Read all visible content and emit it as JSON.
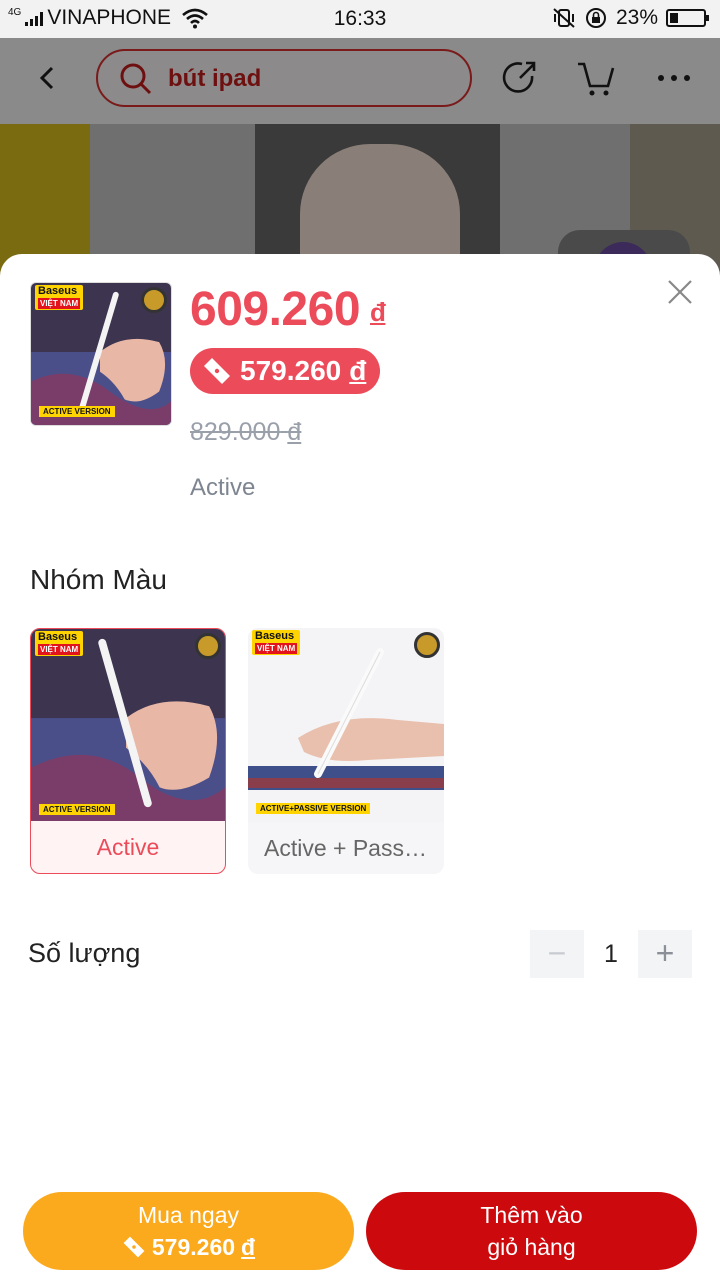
{
  "status_bar": {
    "network": "4G",
    "carrier": "VINAPHONE",
    "time": "16:33",
    "battery": "23%",
    "battery_level": 0.23
  },
  "header": {
    "search_query": "bút ipad",
    "icons": [
      "back-icon",
      "search-icon",
      "share-icon",
      "cart-icon",
      "more-icon"
    ]
  },
  "product": {
    "price": "609.260",
    "currency": "đ",
    "voucher_price": "579.260",
    "original_price": "829.000",
    "selected_variant": "Active",
    "image_badge": "Baseus",
    "image_badge_sub": "VIỆT NAM",
    "image_version": "ACTIVE VERSION"
  },
  "variants": {
    "title": "Nhóm Màu",
    "options": [
      {
        "label": "Active",
        "version": "ACTIVE VERSION",
        "selected": true
      },
      {
        "label": "Active + Passive",
        "version": "ACTIVE+PASSIVE VERSION",
        "selected": false
      }
    ]
  },
  "quantity": {
    "label": "Số lượng",
    "value": "1",
    "minus": "−",
    "plus": "+"
  },
  "actions": {
    "buy_label": "Mua ngay",
    "buy_price": "579.260",
    "cart_line1": "Thêm vào",
    "cart_line2": "giỏ hàng"
  },
  "colors": {
    "accent": "#ec4b5a",
    "buy_button": "#fbaa1d",
    "cart_button": "#cc0a0e"
  }
}
